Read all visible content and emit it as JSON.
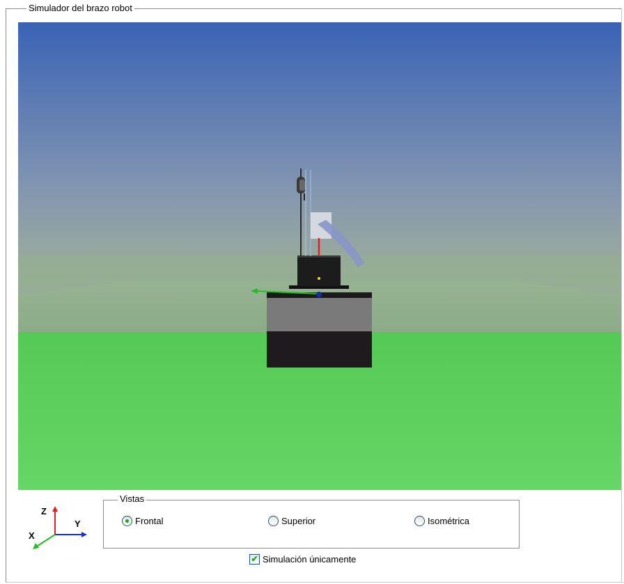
{
  "panel": {
    "title": "Simulador del brazo robot"
  },
  "axes": {
    "z": "Z",
    "y": "Y",
    "x": "X"
  },
  "views": {
    "label": "Vistas",
    "options": [
      {
        "label": "Frontal",
        "selected": true
      },
      {
        "label": "Superior",
        "selected": false
      },
      {
        "label": "Isométrica",
        "selected": false
      }
    ]
  },
  "simulation_only": {
    "label": "Simulación únicamente",
    "checked": true
  },
  "colors": {
    "sky_top": "#3a63b6",
    "sky_bottom": "#9aaa9c",
    "ground": "#5cd45c",
    "radio_dot": "#21a121",
    "checkbox_check": "#21a121",
    "axis_z": "#e02020",
    "axis_y": "#1030e0",
    "axis_x": "#20c020"
  }
}
